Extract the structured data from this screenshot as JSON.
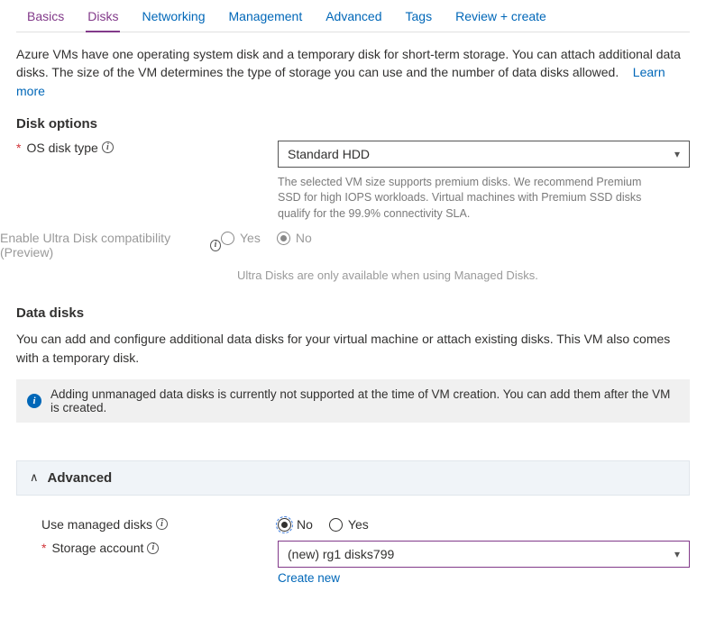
{
  "tabs": {
    "basics": "Basics",
    "disks": "Disks",
    "networking": "Networking",
    "management": "Management",
    "advanced": "Advanced",
    "tags": "Tags",
    "review": "Review + create"
  },
  "intro": {
    "text": "Azure VMs have one operating system disk and a temporary disk for short-term storage. You can attach additional data disks. The size of the VM determines the type of storage you can use and the number of data disks allowed.",
    "learn_more": "Learn more"
  },
  "disk_options": {
    "heading": "Disk options",
    "os_disk_type_label": "OS disk type",
    "os_disk_type_value": "Standard HDD",
    "os_disk_hint": "The selected VM size supports premium disks. We recommend Premium SSD for high IOPS workloads. Virtual machines with Premium SSD disks qualify for the 99.9% connectivity SLA.",
    "ultra_label": "Enable Ultra Disk compatibility (Preview)",
    "yes": "Yes",
    "no": "No",
    "ultra_note": "Ultra Disks are only available when using Managed Disks."
  },
  "data_disks": {
    "heading": "Data disks",
    "body": "You can add and configure additional data disks for your virtual machine or attach existing disks. This VM also comes with a temporary disk.",
    "banner": "Adding unmanaged data disks is currently not supported at the time of VM creation. You can add them after the VM is created."
  },
  "advanced": {
    "title": "Advanced",
    "use_managed_label": "Use managed disks",
    "no": "No",
    "yes": "Yes",
    "storage_account_label": "Storage account",
    "storage_account_value": "(new) rg1 disks799",
    "create_new": "Create new"
  }
}
